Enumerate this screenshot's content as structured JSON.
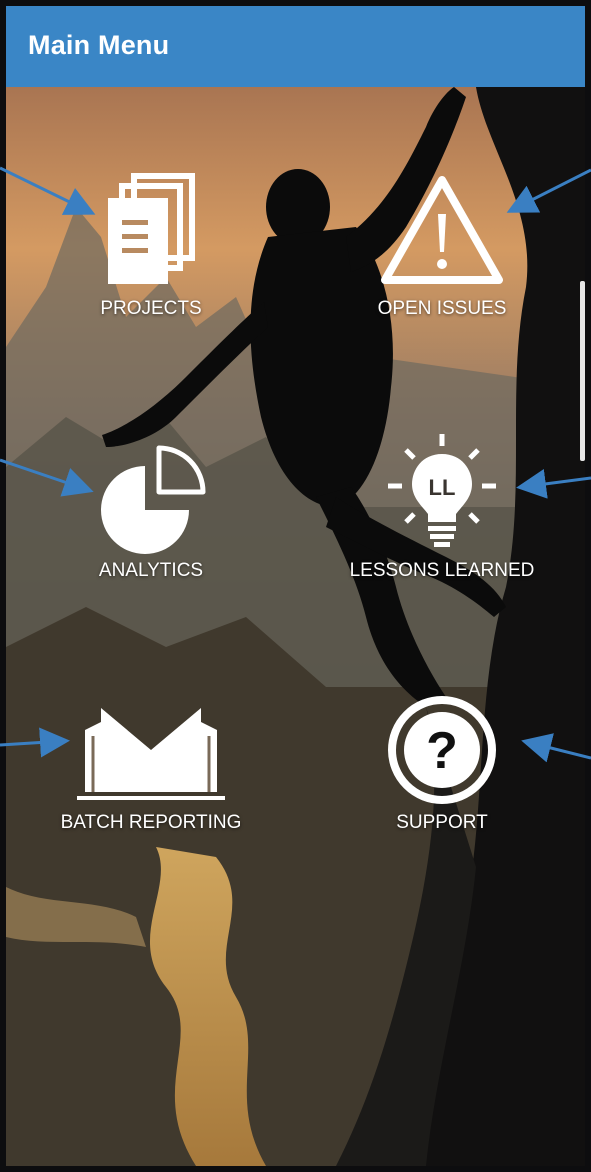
{
  "header": {
    "title": "Main Menu",
    "background": "#3a86c6"
  },
  "menu": {
    "items": [
      {
        "label": "PROJECTS",
        "icon": "documents-icon"
      },
      {
        "label": "OPEN ISSUES",
        "icon": "warning-triangle-icon"
      },
      {
        "label": "ANALYTICS",
        "icon": "pie-chart-icon"
      },
      {
        "label": "LESSONS LEARNED",
        "icon": "lightbulb-icon"
      },
      {
        "label": "BATCH REPORTING",
        "icon": "envelope-icon"
      },
      {
        "label": "SUPPORT",
        "icon": "question-circle-icon"
      }
    ]
  },
  "colors": {
    "label_text": "#ffffff",
    "annotation_arrow": "#3a7fc2"
  }
}
